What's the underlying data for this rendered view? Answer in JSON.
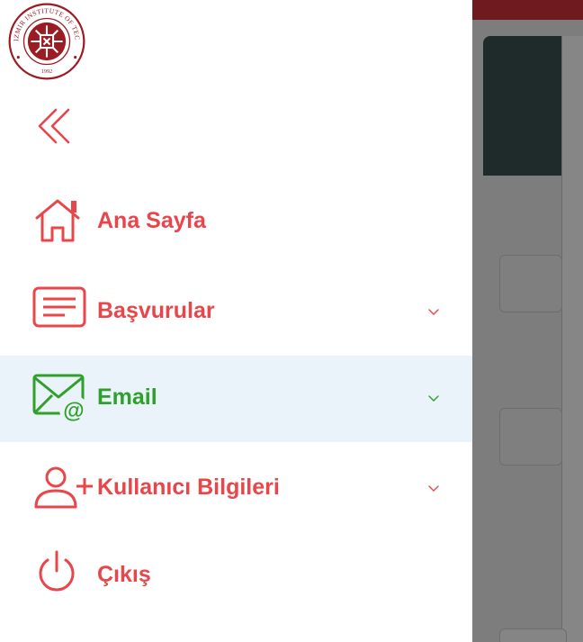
{
  "logo": {
    "ring_text": "IZMIR INSTITUTE OF TECHNOLOGY",
    "year": "1992",
    "color": "#9b1c22"
  },
  "colors": {
    "accent": "#e8464a",
    "active": "#2fa12b",
    "active_bg": "#eaf2fa"
  },
  "drawer": {
    "collapse_icon": "double-chevron-left-icon",
    "items": [
      {
        "label": "Ana Sayfa",
        "icon": "home-icon",
        "expandable": false,
        "active": false
      },
      {
        "label": "Başvurular",
        "icon": "document-icon",
        "expandable": true,
        "active": false
      },
      {
        "label": "Email",
        "icon": "email-at-icon",
        "expandable": true,
        "active": true
      },
      {
        "label": "Kullanıcı Bilgileri",
        "icon": "user-add-icon",
        "expandable": true,
        "active": false
      },
      {
        "label": "Çıkış",
        "icon": "power-icon",
        "expandable": false,
        "active": false
      }
    ]
  }
}
